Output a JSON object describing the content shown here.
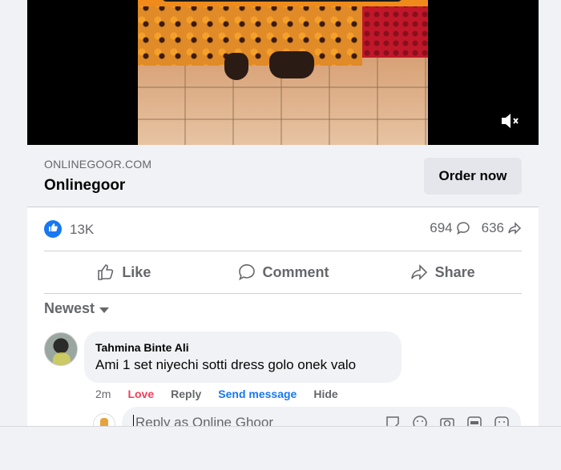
{
  "link_preview": {
    "domain": "ONLINEGOOR.COM",
    "title": "Onlinegoor",
    "cta_label": "Order now"
  },
  "reactions": {
    "like_count": "13K",
    "comment_count": "694",
    "share_count": "636"
  },
  "actions": {
    "like_label": "Like",
    "comment_label": "Comment",
    "share_label": "Share"
  },
  "sort": {
    "label": "Newest"
  },
  "comment": {
    "author": "Tahmina Binte Ali",
    "text": "Ami 1 set niyechi sotti dress golo onek valo",
    "time": "2m",
    "reaction_label": "Love",
    "reply_label": "Reply",
    "send_message_label": "Send message",
    "hide_label": "Hide"
  },
  "reply_box": {
    "placeholder": "Reply as Online Ghoor"
  },
  "colors": {
    "accent": "#1877f2",
    "love": "#f33e58",
    "secondary_text": "#65676b"
  }
}
